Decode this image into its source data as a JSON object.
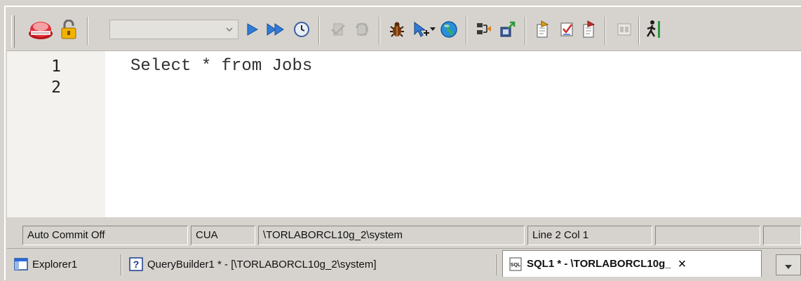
{
  "toolbar": {
    "icons": [
      "database-connection-icon",
      "lock-icon",
      "execute-icon",
      "execute-script-icon",
      "explain-plan-icon",
      "commit-icon",
      "rollback-icon",
      "debug-icon",
      "step-icon",
      "web-icon",
      "format-icon",
      "export-icon",
      "history-icon",
      "check-icon",
      "describe-icon",
      "output-icon",
      "run-person-icon"
    ],
    "connection_combo_value": ""
  },
  "editor": {
    "line_numbers": [
      "1",
      "2"
    ],
    "lines": [
      "Select * from Jobs",
      ""
    ]
  },
  "statusbar": {
    "commit_mode": "Auto Commit Off",
    "keymap": "CUA",
    "connection": "\\TORLABORCL10g_2\\system",
    "cursor_position": "Line 2 Col 1",
    "extra_1": "",
    "extra_2": ""
  },
  "tabs": [
    {
      "label": "Explorer1",
      "icon": "explorer-window-icon",
      "active": false
    },
    {
      "label": "QueryBuilder1 * - [\\TORLABORCL10g_2\\system]",
      "icon": "help-question-icon",
      "active": false
    },
    {
      "label": "SQL1 * - \\TORLABORCL10g_",
      "icon": "sql-file-icon",
      "active": true,
      "close": "×"
    }
  ],
  "colors": {
    "chrome": "#d6d3ce",
    "editor_bg": "#ffffff",
    "gutter_bg": "#f3f2ee",
    "execute_blue": "#2f7bd8",
    "connection_red": "#d8323a"
  }
}
